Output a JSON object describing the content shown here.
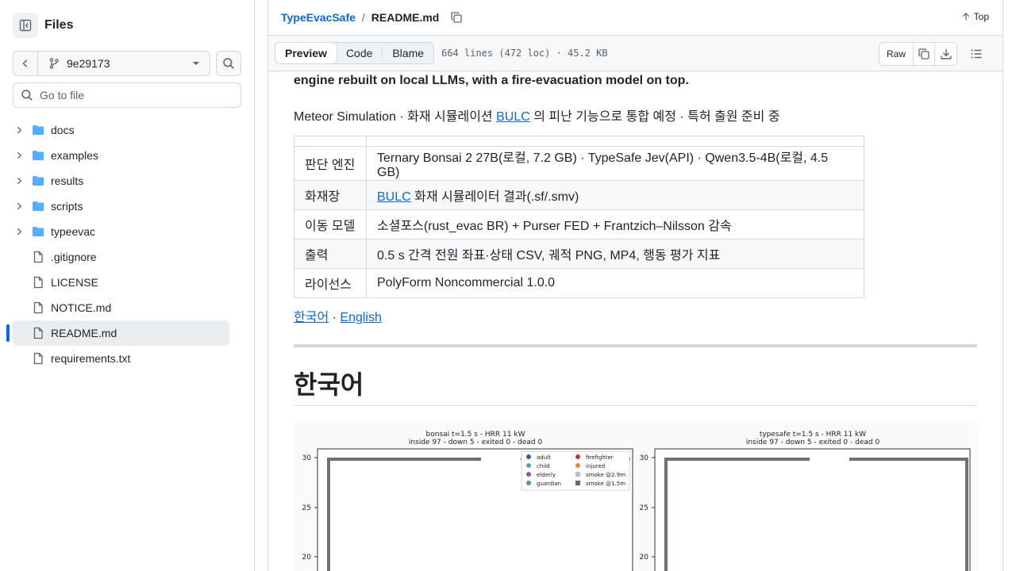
{
  "sidebar": {
    "title": "Files",
    "branch": "9e29173",
    "goto_placeholder": "Go to file",
    "items": [
      {
        "label": "docs",
        "type": "folder"
      },
      {
        "label": "examples",
        "type": "folder"
      },
      {
        "label": "results",
        "type": "folder"
      },
      {
        "label": "scripts",
        "type": "folder"
      },
      {
        "label": "typeevac",
        "type": "folder"
      },
      {
        "label": ".gitignore",
        "type": "file"
      },
      {
        "label": "LICENSE",
        "type": "file"
      },
      {
        "label": "NOTICE.md",
        "type": "file"
      },
      {
        "label": "README.md",
        "type": "file",
        "active": true
      },
      {
        "label": "requirements.txt",
        "type": "file"
      }
    ]
  },
  "header": {
    "repo": "TypeEvacSafe",
    "separator": "/",
    "file": "README.md",
    "top_label": "Top"
  },
  "toolbar": {
    "tabs": [
      "Preview",
      "Code",
      "Blame"
    ],
    "active_tab": "Preview",
    "meta": "664 lines (472 loc) · 45.2 KB",
    "raw_label": "Raw"
  },
  "readme": {
    "intro_bold": "engine rebuilt on local LLMs, with a fire-evacuation model on top.",
    "intro_pre": "Meteor Simulation · 화재 시뮬레이션 ",
    "intro_link": "BULC",
    "intro_post": " 의 피난 기능으로 통합 예정 · 특허 출원 준비 중",
    "table": [
      {
        "k": "판단 엔진",
        "v": "Ternary Bonsai 2 27B(로컬, 7.2 GB) · TypeSafe Jev(API) · Qwen3.5-4B(로컬, 4.5 GB)"
      },
      {
        "k": "화재장",
        "v_link": "BULC",
        "v": " 화재 시뮬레이터 결과(.sf/.smv)"
      },
      {
        "k": "이동 모델",
        "v": "소셜포스(rust_evac BR) + Purser FED + Frantzich–Nilsson 감속"
      },
      {
        "k": "출력",
        "v": "0.5 s 간격 전원 좌표·상태 CSV, 궤적 PNG, MP4, 행동 평가 지표"
      },
      {
        "k": "라이선스",
        "v": "PolyForm Noncommercial 1.0.0"
      }
    ],
    "lang_korean": "한국어",
    "lang_sep": " · ",
    "lang_english": "English",
    "heading": "한국어"
  },
  "figure": {
    "left": {
      "title": "bonsai   t=1.5 s - HRR 11 kW",
      "subtitle": "inside 97 - down 5 - exited 0 - dead 0",
      "yticks": [
        "30",
        "25",
        "20"
      ]
    },
    "right": {
      "title": "typesafe   t=1.5 s - HRR 11 kW",
      "subtitle": "inside 97 - down 5 - exited 0 - dead 0",
      "yticks": [
        "30",
        "25",
        "20"
      ]
    },
    "legend": [
      {
        "label": "adult",
        "color": "#3a5f9e"
      },
      {
        "label": "firefighter",
        "color": "#c0392b"
      },
      {
        "label": "child",
        "color": "#5aa6a0"
      },
      {
        "label": "injured",
        "color": "#e08a3c"
      },
      {
        "label": "elderly",
        "color": "#7d5ba6"
      },
      {
        "label": "smoke @2.9m",
        "color": "#bdbdbd"
      },
      {
        "label": "guardian",
        "color": "#5a9e5a"
      },
      {
        "label": "smoke @1.5m",
        "color": "#6b6b6b"
      }
    ]
  },
  "colors": {
    "link": "#0969da",
    "border": "#d1d9e0",
    "folder": "#54aeff",
    "active": "#0969da"
  }
}
